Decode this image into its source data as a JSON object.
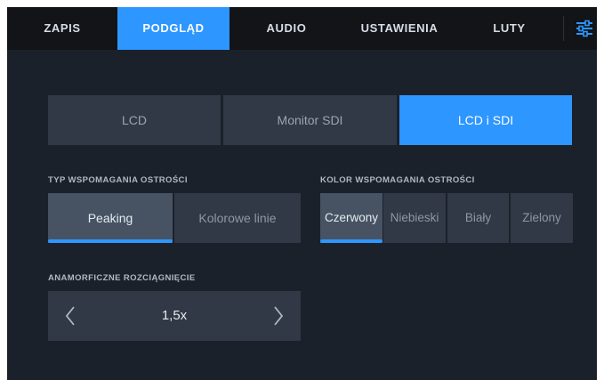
{
  "tabs": [
    {
      "label": "ZAPIS"
    },
    {
      "label": "PODGLĄD"
    },
    {
      "label": "AUDIO"
    },
    {
      "label": "USTAWIENIA"
    },
    {
      "label": "LUTY"
    }
  ],
  "active_tab": "PODGLĄD",
  "output": {
    "options": [
      "LCD",
      "Monitor SDI",
      "LCD i SDI"
    ],
    "selected": "LCD i SDI"
  },
  "focus_assist_type": {
    "label": "TYP WSPOMAGANIA OSTROŚCI",
    "options": [
      "Peaking",
      "Kolorowe linie"
    ],
    "selected": "Peaking"
  },
  "focus_assist_color": {
    "label": "KOLOR WSPOMAGANIA OSTROŚCI",
    "options": [
      "Czerwony",
      "Niebieski",
      "Biały",
      "Zielony"
    ],
    "selected": "Czerwony"
  },
  "anamorphic": {
    "label": "ANAMORFICZNE ROZCIĄGNIĘCIE",
    "value": "1,5x"
  },
  "icons": {
    "menu": "sliders-menu-icon",
    "prev": "chevron-left-icon",
    "next": "chevron-right-icon"
  },
  "colors": {
    "accent": "#2d96ff",
    "background": "#1b212b",
    "tab_bar": "#121417",
    "button": "#303945",
    "button_selected": "#475363"
  }
}
